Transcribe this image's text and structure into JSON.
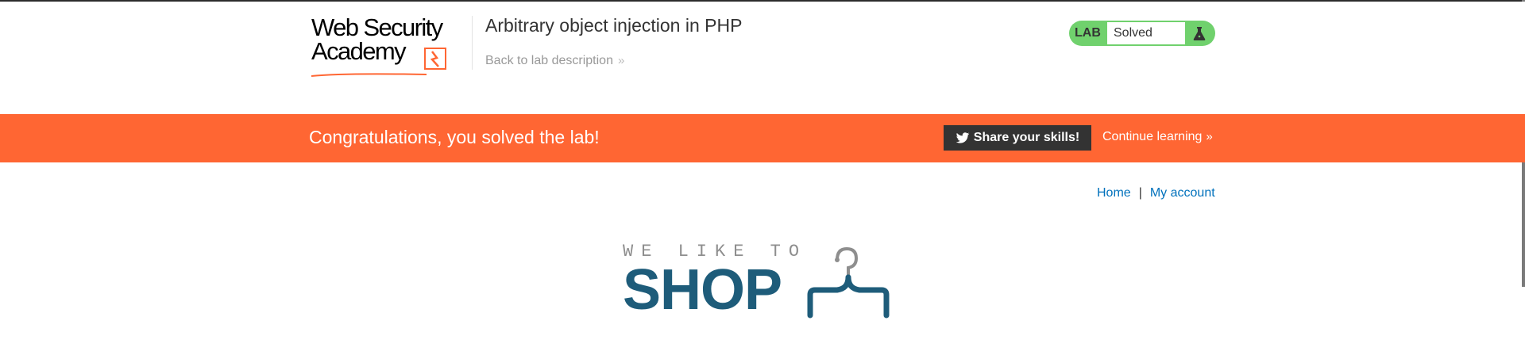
{
  "header": {
    "logo_line1": "Web Security",
    "logo_line2": "Academy",
    "lab_title": "Arbitrary object injection in PHP",
    "back_link": "Back to lab description",
    "lab_badge": "LAB",
    "lab_state": "Solved",
    "lab_state_color": "#70d16d"
  },
  "banner": {
    "message": "Congratulations, you solved the lab!",
    "share_label": "Share your skills!",
    "continue_label": "Continue learning",
    "color": "#ff6633"
  },
  "nav": {
    "home": "Home",
    "separator": "|",
    "my_account": "My account"
  },
  "shop_logo": {
    "tagline": "WE LIKE TO",
    "word": "SHOP",
    "color": "#1e5c7a"
  },
  "icons": {
    "back_chevron": "double-chevron-right",
    "continue_chevron": "double-chevron-right",
    "share_icon": "twitter-bird",
    "lab_icon": "flask"
  }
}
